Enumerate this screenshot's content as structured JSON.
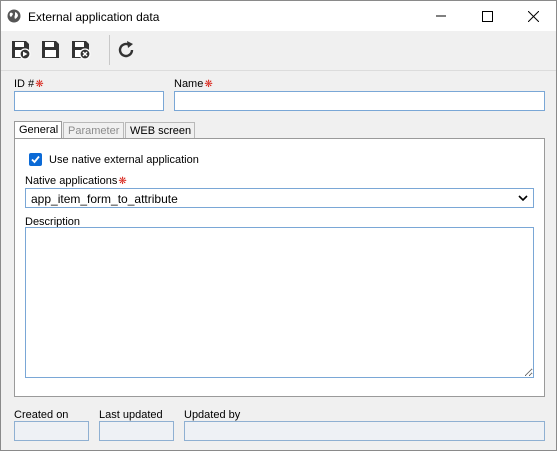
{
  "window": {
    "title": "External application data",
    "icon": "globe-icon"
  },
  "toolbar": {
    "buttons": [
      {
        "name": "save-and-new-button",
        "icon": "floppy-plus-icon"
      },
      {
        "name": "save-button",
        "icon": "floppy-icon"
      },
      {
        "name": "save-and-close-button",
        "icon": "floppy-close-icon"
      },
      {
        "name": "refresh-button",
        "icon": "refresh-icon"
      }
    ]
  },
  "form": {
    "id_label": "ID #",
    "id_value": "",
    "name_label": "Name",
    "name_value": ""
  },
  "tabs": [
    {
      "label": "General",
      "active": true,
      "enabled": true
    },
    {
      "label": "Parameter",
      "active": false,
      "enabled": false
    },
    {
      "label": "WEB screen",
      "active": false,
      "enabled": true
    }
  ],
  "general": {
    "use_native_label": "Use native external application",
    "use_native_checked": true,
    "native_apps_label": "Native applications",
    "native_apps_value": "app_item_form_to_attribute",
    "description_label": "Description",
    "description_value": ""
  },
  "footer": {
    "created_on_label": "Created on",
    "created_on_value": "",
    "last_updated_label": "Last updated",
    "last_updated_value": "",
    "updated_by_label": "Updated by",
    "updated_by_value": ""
  },
  "colors": {
    "required": "#d9261c",
    "checkbox": "#0b6ad6",
    "input_border": "#7aa7d6"
  }
}
